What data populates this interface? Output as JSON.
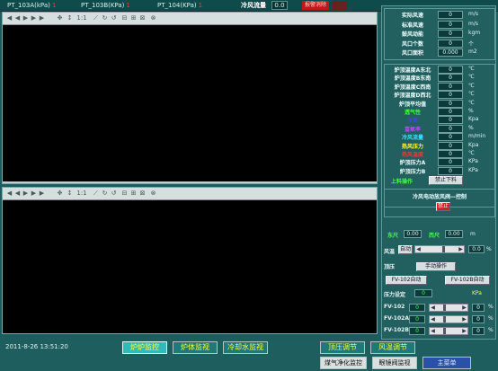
{
  "topbar": {
    "pt1_label": "PT_103A(kPa)",
    "pt1_value": "1",
    "pt2_label": "PT_103B(KPa)",
    "pt2_value": "1",
    "pt3_label": "PT_104(KPa)",
    "pt3_value": "1",
    "cool_label": "冷风流量",
    "cool_value": "0.0",
    "alarm_label": "报警消除"
  },
  "trend_toolbar_icons": [
    "first-icon",
    "back-icon",
    "play-icon",
    "forward-icon",
    "last-icon",
    "zoom-icon",
    "scale-icon",
    "chart-icon",
    "config-icon",
    "list-icon",
    "export-icon",
    "stop-icon"
  ],
  "trend_toolbar_text": "1:1",
  "right_panel": {
    "flow_rows": [
      {
        "label": "实际风速",
        "value": "0",
        "unit": "m/s"
      },
      {
        "label": "标准风速",
        "value": "0",
        "unit": "m/s"
      },
      {
        "label": "鼓风动能",
        "value": "0",
        "unit": "kgm"
      },
      {
        "label": "风口个数",
        "value": "0",
        "unit": "个"
      },
      {
        "label": "风口面积",
        "value": "0.000",
        "unit": "m2"
      }
    ],
    "furnace_rows": [
      {
        "label": "炉顶温度A东北",
        "value": "0",
        "unit": "℃",
        "color": "#f0ffff"
      },
      {
        "label": "炉顶温度B东南",
        "value": "0",
        "unit": "℃",
        "color": "#f0ffff"
      },
      {
        "label": "炉顶温度C西南",
        "value": "0",
        "unit": "℃",
        "color": "#f0ffff"
      },
      {
        "label": "炉顶温度D西北",
        "value": "0",
        "unit": "℃",
        "color": "#f0ffff"
      },
      {
        "label": "炉顶平均值",
        "value": "0",
        "unit": "℃",
        "color": "#f0ffff"
      },
      {
        "label": "透气性",
        "value": "0",
        "unit": "%",
        "color": "#40ff40"
      },
      {
        "label": "压差",
        "value": "0",
        "unit": "Kpa",
        "color": "#4040ff"
      },
      {
        "label": "富氧率",
        "value": "0",
        "unit": "%",
        "color": "#c040ff"
      },
      {
        "label": "冷风流量",
        "value": "0",
        "unit": "m/min",
        "color": "#40e0ff"
      },
      {
        "label": "热风压力",
        "value": "0",
        "unit": "Kpa",
        "color": "#ffff40"
      },
      {
        "label": "热风温度",
        "value": "0",
        "unit": "℃",
        "color": "#ff3030"
      },
      {
        "label": "炉顶压力A",
        "value": "0",
        "unit": "KPa",
        "color": "#f0ffff"
      },
      {
        "label": "炉顶压力B",
        "value": "0",
        "unit": "KPa",
        "color": "#f0ffff"
      }
    ],
    "feed_label": "上料操作",
    "feed_button": "禁止下料",
    "damper_title": "冷风电动放风阀—控制",
    "damper_button": "禁止",
    "ruler": {
      "east_label": "东尺",
      "east_value": "0.00",
      "west_label": "西尺",
      "west_value": "0.00",
      "unit": "m"
    },
    "fan": {
      "label": "风温",
      "mode": "自动",
      "value": "0.0",
      "unit": "%",
      "level": 0.6
    },
    "fan_level": {
      "label": "顶压"
    },
    "manual_button": "手动操作",
    "fv102_auto": "FV-102自动",
    "fv102b_auto": "FV-102B自动",
    "pressure_set": {
      "label": "压力设定",
      "value": "0",
      "unit": "KPa"
    },
    "valves": [
      {
        "label": "FV-102",
        "value": "0",
        "unit": "%",
        "level": 0.3
      },
      {
        "label": "FV-102A",
        "value": "0",
        "unit": "%",
        "level": 0.3
      },
      {
        "label": "FV-102B",
        "value": "0",
        "unit": "%",
        "level": 0.3
      }
    ]
  },
  "bottom": {
    "datetime": "2011-8-26  13:51:20",
    "tabs": [
      "炉炉监控",
      "炉体监视",
      "冷却水监视"
    ],
    "right_tabs": [
      "顶压调节",
      "风温调节"
    ],
    "nav": [
      "煤气净化监控",
      "眼镜阀监视",
      "主菜单"
    ]
  },
  "colors": {
    "background": "#1d5d5d",
    "accent": "#35b8b8",
    "alarm": "#c01818"
  }
}
